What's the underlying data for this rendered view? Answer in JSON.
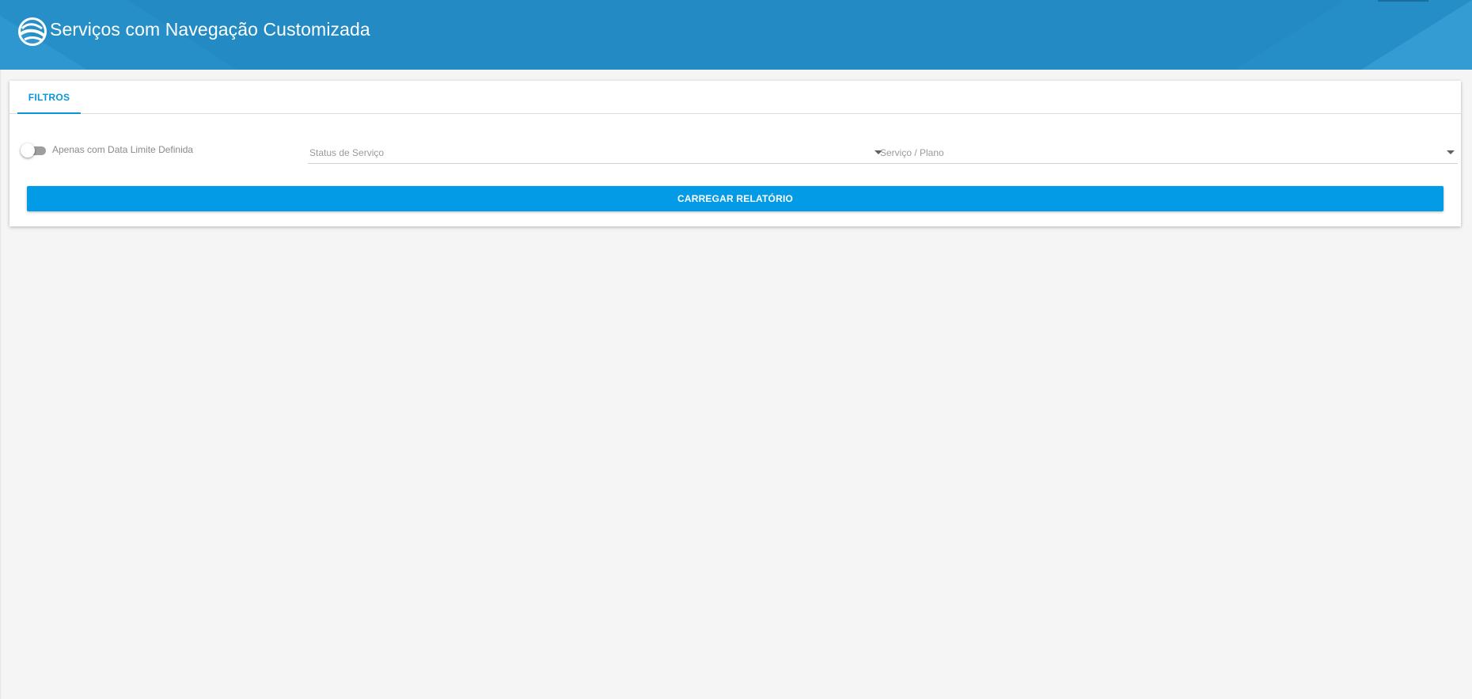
{
  "header": {
    "title": "Serviços com Navegação Customizada",
    "logo_icon": "globe-wave-logo-icon",
    "background_color": "#238ac3"
  },
  "tabs": [
    {
      "label": "FILTROS",
      "active": true
    }
  ],
  "filters": {
    "toggle": {
      "label": "Apenas com Data Limite Definida",
      "checked": false
    },
    "status_select": {
      "placeholder": "Status de Serviço",
      "icon": "dropdown-arrow-icon"
    },
    "servico_select": {
      "placeholder": "Serviço / Plano",
      "icon": "dropdown-arrow-icon"
    }
  },
  "actions": {
    "load_report_label": "CARREGAR RELATÓRIO"
  },
  "colors": {
    "accent": "#0b95d9",
    "button": "#039be5",
    "background": "#f5f5f5"
  }
}
